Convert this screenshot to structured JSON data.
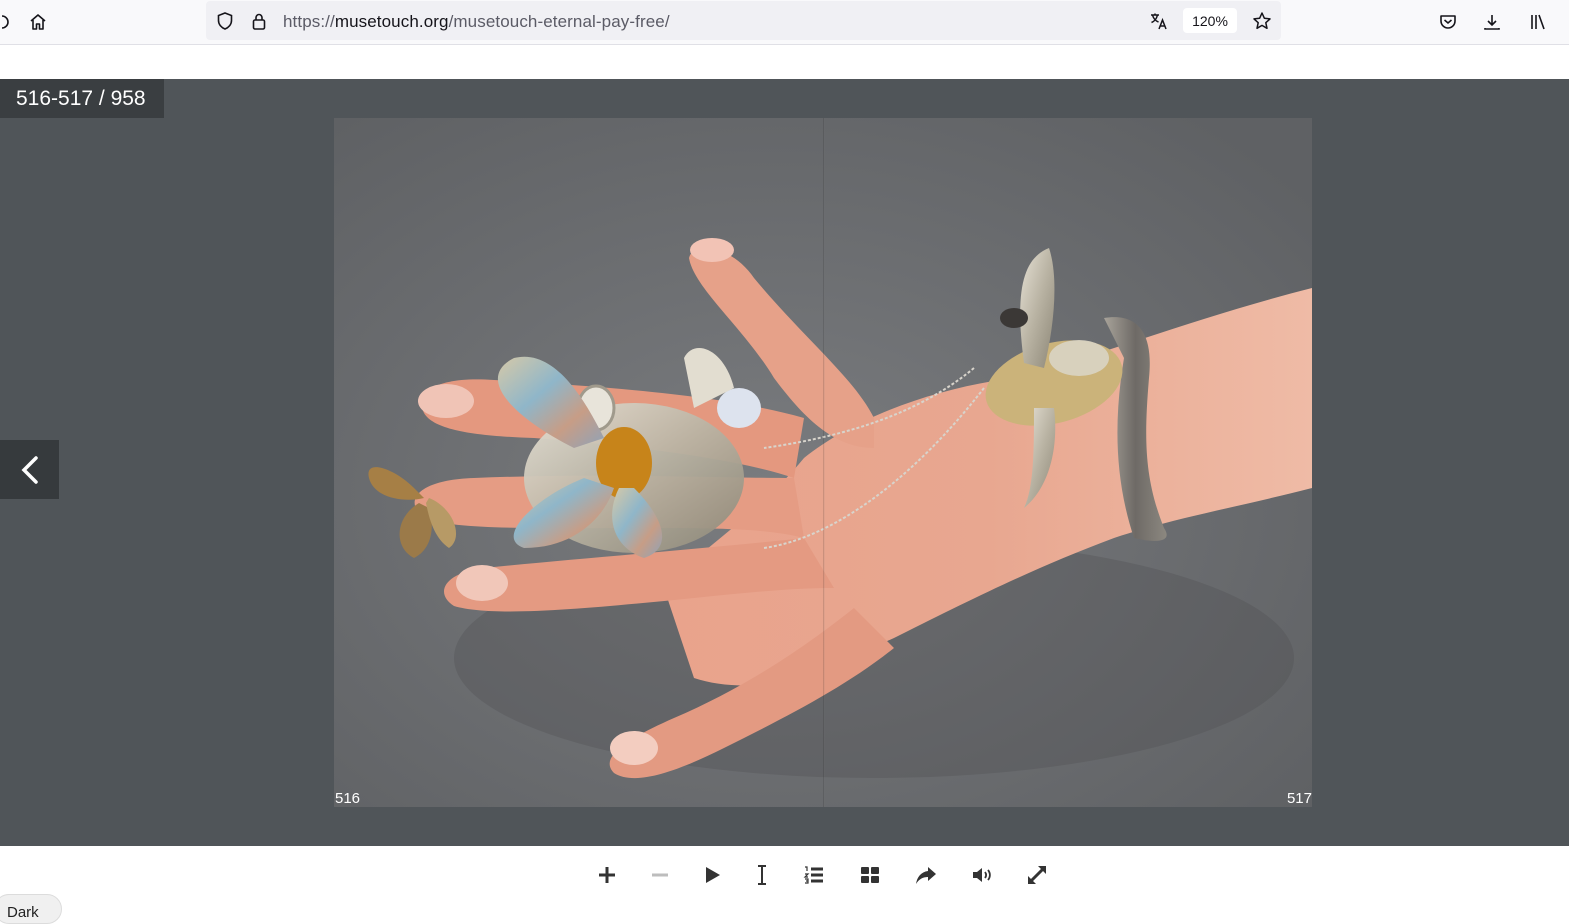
{
  "browser": {
    "url_scheme": "https://",
    "url_domain": "musetouch.org",
    "url_path": "/musetouch-eternal-pay-free/",
    "zoom_label": "120%",
    "icons": [
      "home-icon",
      "shield-icon",
      "lock-icon",
      "translate-icon",
      "star-icon",
      "pocket-icon",
      "download-icon",
      "library-icon"
    ]
  },
  "viewer": {
    "page_counter": "516-517 / 958",
    "left_page_number": "516",
    "right_page_number": "517",
    "background": "#505559"
  },
  "controls": {
    "icons": [
      "zoom-in-icon",
      "zoom-out-icon",
      "play-icon",
      "text-select-icon",
      "table-of-contents-icon",
      "thumbnails-icon",
      "share-icon",
      "sound-icon",
      "fullscreen-icon"
    ],
    "theme_label": "Dark"
  }
}
